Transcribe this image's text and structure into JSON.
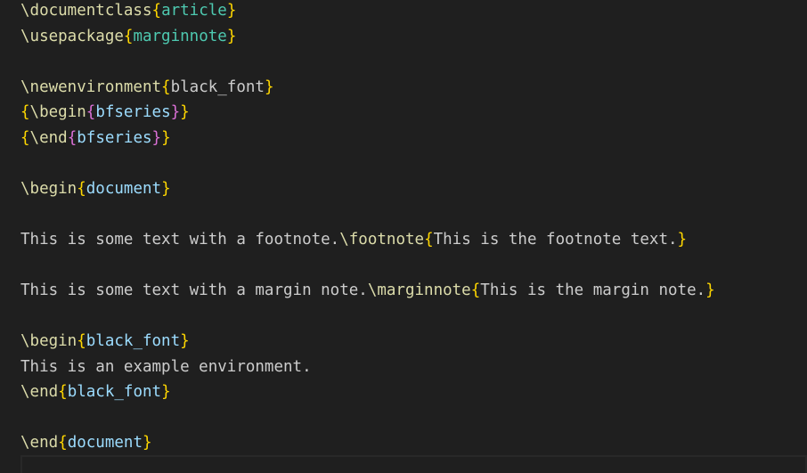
{
  "editor": {
    "lines": [
      [
        {
          "t": "\\documentclass",
          "c": "cmd"
        },
        {
          "t": "{",
          "c": "brace"
        },
        {
          "t": "article",
          "c": "arg"
        },
        {
          "t": "}",
          "c": "brace"
        }
      ],
      [
        {
          "t": "\\usepackage",
          "c": "cmd"
        },
        {
          "t": "{",
          "c": "brace"
        },
        {
          "t": "marginnote",
          "c": "arg"
        },
        {
          "t": "}",
          "c": "brace"
        }
      ],
      [],
      [
        {
          "t": "\\newenvironment",
          "c": "cmd"
        },
        {
          "t": "{",
          "c": "brace"
        },
        {
          "t": "black_font",
          "c": "text"
        },
        {
          "t": "}",
          "c": "brace"
        }
      ],
      [
        {
          "t": "{",
          "c": "brace"
        },
        {
          "t": "\\begin",
          "c": "cmd"
        },
        {
          "t": "{",
          "c": "inner"
        },
        {
          "t": "bfseries",
          "c": "env"
        },
        {
          "t": "}",
          "c": "inner"
        },
        {
          "t": "}",
          "c": "brace"
        }
      ],
      [
        {
          "t": "{",
          "c": "brace"
        },
        {
          "t": "\\end",
          "c": "cmd"
        },
        {
          "t": "{",
          "c": "inner"
        },
        {
          "t": "bfseries",
          "c": "env"
        },
        {
          "t": "}",
          "c": "inner"
        },
        {
          "t": "}",
          "c": "brace"
        }
      ],
      [],
      [
        {
          "t": "\\begin",
          "c": "cmd"
        },
        {
          "t": "{",
          "c": "brace"
        },
        {
          "t": "document",
          "c": "env"
        },
        {
          "t": "}",
          "c": "brace"
        }
      ],
      [],
      [
        {
          "t": "This is some text with a footnote.",
          "c": "text"
        },
        {
          "t": "\\footnote",
          "c": "cmd"
        },
        {
          "t": "{",
          "c": "brace"
        },
        {
          "t": "This is the footnote text.",
          "c": "text"
        },
        {
          "t": "}",
          "c": "brace"
        }
      ],
      [],
      [
        {
          "t": "This is some text with a margin note.",
          "c": "text"
        },
        {
          "t": "\\marginnote",
          "c": "cmd"
        },
        {
          "t": "{",
          "c": "brace"
        },
        {
          "t": "This is the margin note.",
          "c": "text"
        },
        {
          "t": "}",
          "c": "brace"
        }
      ],
      [],
      [
        {
          "t": "\\begin",
          "c": "cmd"
        },
        {
          "t": "{",
          "c": "brace"
        },
        {
          "t": "black_font",
          "c": "env"
        },
        {
          "t": "}",
          "c": "brace"
        }
      ],
      [
        {
          "t": "This is an example environment.",
          "c": "text"
        }
      ],
      [
        {
          "t": "\\end",
          "c": "cmd"
        },
        {
          "t": "{",
          "c": "brace"
        },
        {
          "t": "black_font",
          "c": "env"
        },
        {
          "t": "}",
          "c": "brace"
        }
      ],
      [],
      [
        {
          "t": "\\end",
          "c": "cmd"
        },
        {
          "t": "{",
          "c": "brace"
        },
        {
          "t": "document",
          "c": "env"
        },
        {
          "t": "}",
          "c": "brace"
        }
      ]
    ]
  },
  "colors": {
    "background": "#1f1f1f",
    "command": "#dcdcaa",
    "brace_outer": "#ffd700",
    "brace_inner": "#da70d6",
    "argument": "#4ec9b0",
    "environment": "#9cdcfe",
    "text": "#cccccc"
  }
}
